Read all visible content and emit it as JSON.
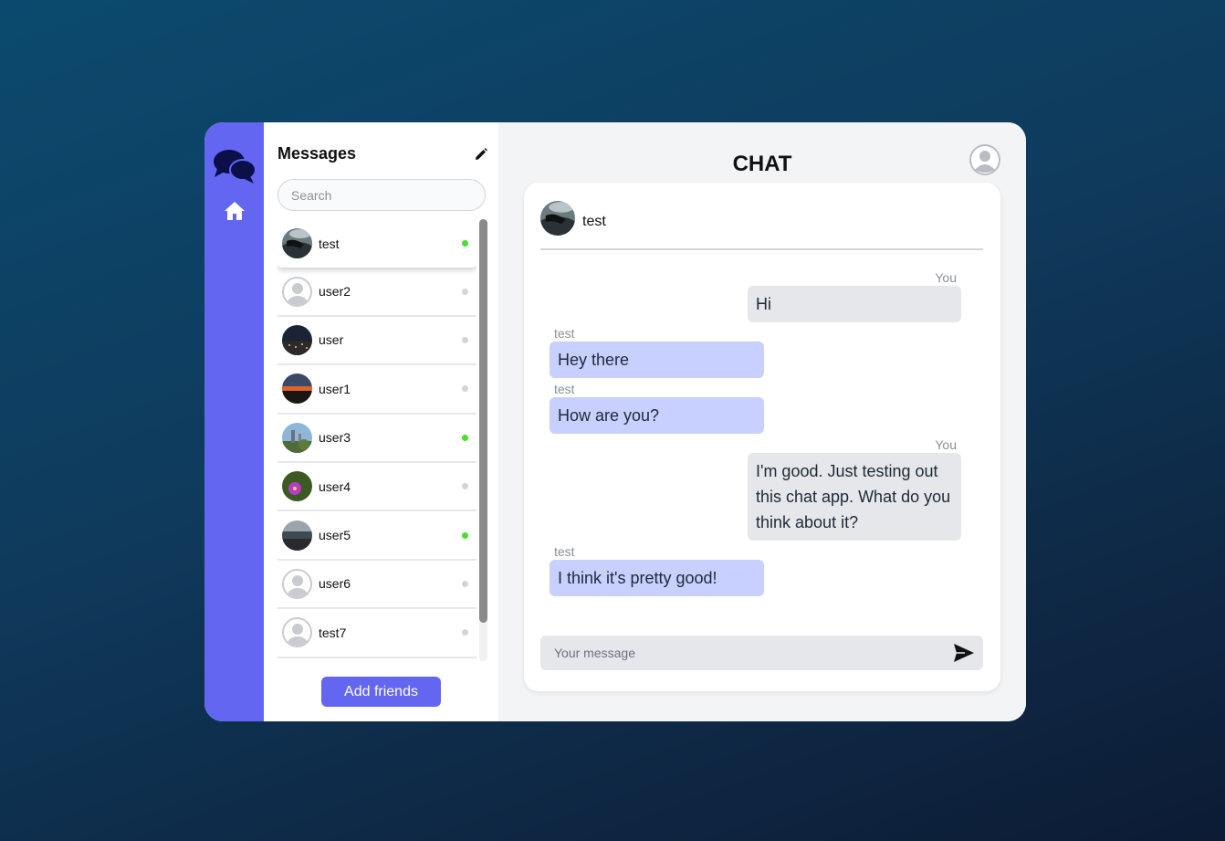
{
  "sidebar": {
    "logo_icon": "chat-bubbles-icon",
    "home_icon": "home-icon"
  },
  "panel": {
    "title": "Messages",
    "edit_icon": "pencil-icon",
    "search_placeholder": "Search",
    "contacts": [
      {
        "name": "test",
        "online": true,
        "avatar": "photo",
        "active": true
      },
      {
        "name": "user2",
        "online": false,
        "avatar": "default"
      },
      {
        "name": "user",
        "online": false,
        "avatar": "photo"
      },
      {
        "name": "user1",
        "online": false,
        "avatar": "photo"
      },
      {
        "name": "user3",
        "online": true,
        "avatar": "photo"
      },
      {
        "name": "user4",
        "online": false,
        "avatar": "photo"
      },
      {
        "name": "user5",
        "online": true,
        "avatar": "photo"
      },
      {
        "name": "user6",
        "online": false,
        "avatar": "default"
      },
      {
        "name": "test7",
        "online": false,
        "avatar": "default"
      }
    ],
    "add_friends_label": "Add friends"
  },
  "chat": {
    "title": "CHAT",
    "profile_icon": "user-avatar-icon",
    "partner_name": "test",
    "messages": [
      {
        "sender": "You",
        "text": "Hi",
        "mine": true
      },
      {
        "sender": "test",
        "text": "Hey there",
        "mine": false
      },
      {
        "sender": "test",
        "text": "How are you?",
        "mine": false
      },
      {
        "sender": "You",
        "text": "I'm good. Just testing out this chat app. What do you think about it?",
        "mine": true
      },
      {
        "sender": "test",
        "text": "I think it's pretty good!",
        "mine": false
      }
    ],
    "input_placeholder": "Your message",
    "send_icon": "send-icon"
  },
  "colors": {
    "accent": "#6366f1",
    "online": "#4ade2e",
    "their_bubble": "#c7d0ff",
    "my_bubble": "#e5e7eb"
  }
}
